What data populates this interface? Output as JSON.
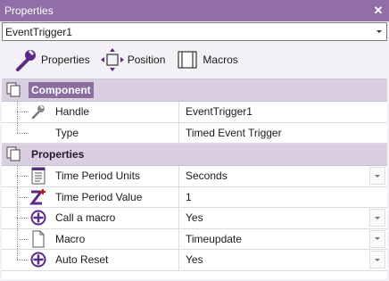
{
  "window": {
    "title": "Properties",
    "close_glyph": "✕"
  },
  "object_select": {
    "value": "EventTrigger1"
  },
  "tabs": [
    {
      "label": "Properties",
      "icon": "wrench-icon"
    },
    {
      "label": "Position",
      "icon": "move-arrows-icon"
    },
    {
      "label": "Macros",
      "icon": "macro-icon"
    }
  ],
  "sections": {
    "component": {
      "label": "Component",
      "rows": [
        {
          "name": "Handle",
          "value": "EventTrigger1",
          "icon": "wrench-icon"
        },
        {
          "name": "Type",
          "value": "Timed Event Trigger"
        }
      ]
    },
    "properties": {
      "label": "Properties",
      "rows": [
        {
          "name": "Time Period Units",
          "value": "Seconds",
          "icon": "list-document-icon",
          "dropdown": true
        },
        {
          "name": "Time Period Value",
          "value": "1",
          "icon": "z-plus-icon"
        },
        {
          "name": "Call a macro",
          "value": "Yes",
          "icon": "plus-circle-icon",
          "dropdown": true
        },
        {
          "name": "Macro",
          "value": "Timeupdate",
          "icon": "document-icon",
          "dropdown": true
        },
        {
          "name": "Auto Reset",
          "value": "Yes",
          "icon": "plus-circle-icon",
          "dropdown": true
        }
      ]
    }
  },
  "colors": {
    "titlebar": "#8f6fa6",
    "section_bg": "#d9cfe0",
    "selected": "#8a6ea0",
    "icon_purple": "#5b2a86",
    "icon_red": "#cc1111"
  }
}
